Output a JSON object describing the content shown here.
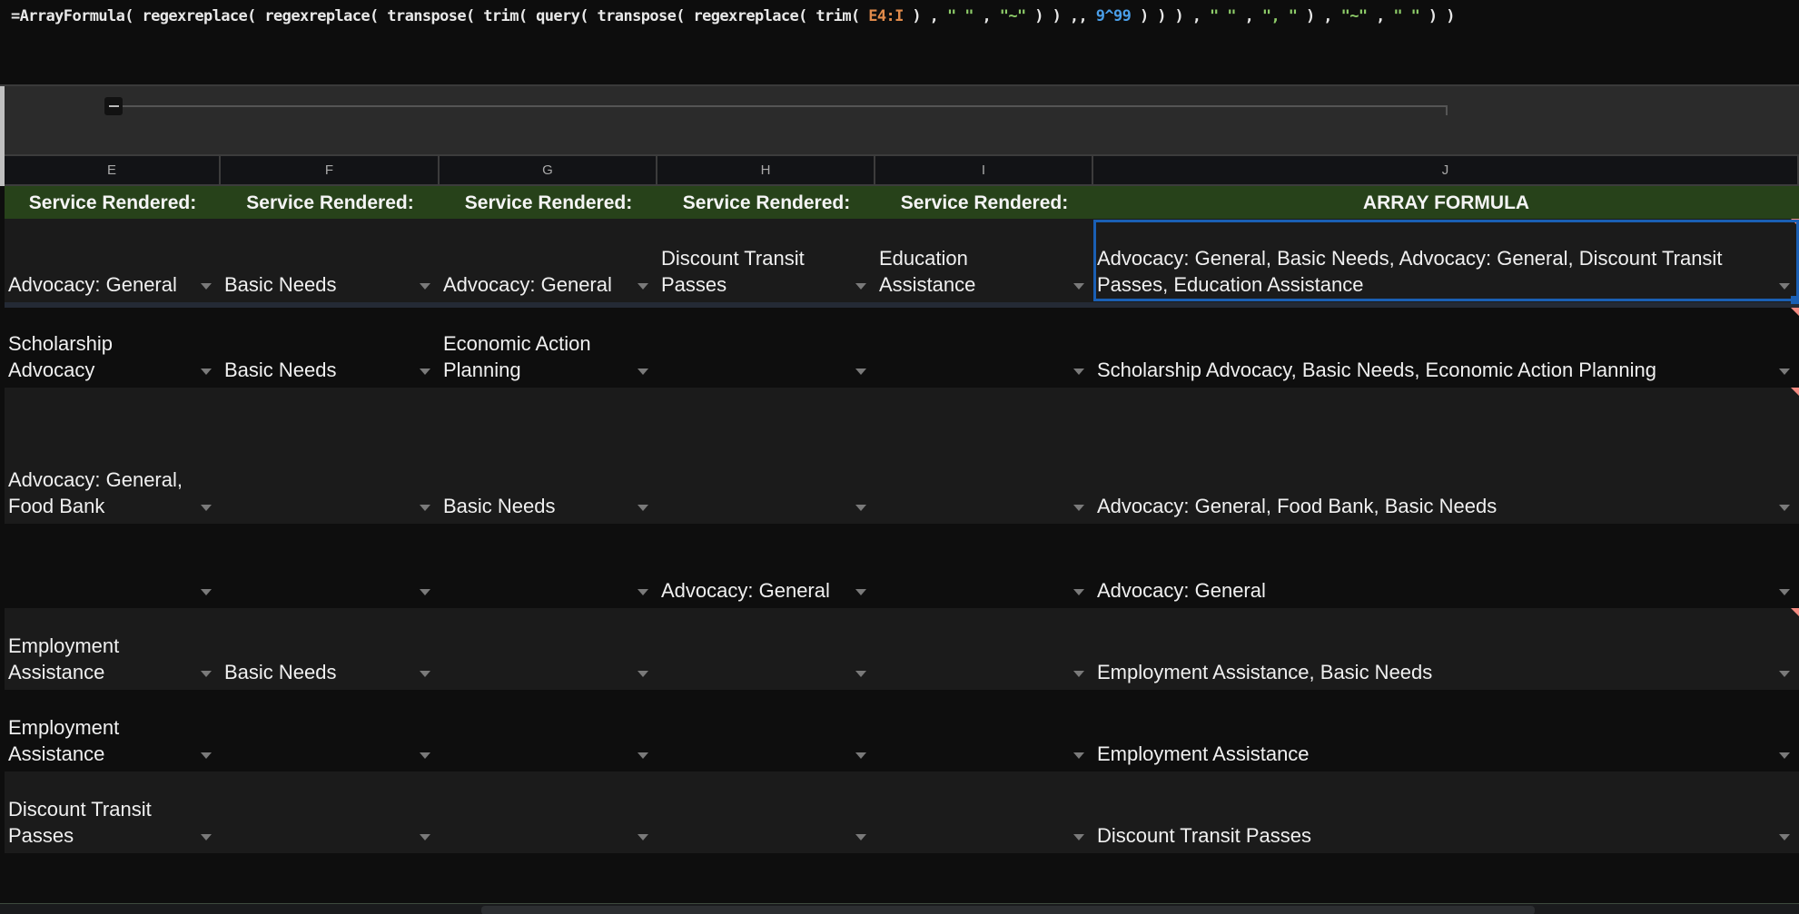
{
  "formula_bar": {
    "parts": [
      {
        "t": "=ArrayFormula( regexreplace( regexreplace( transpose( trim( query( transpose( regexreplace( trim( ",
        "k": "fn"
      },
      {
        "t": "E4:I",
        "k": "range"
      },
      {
        "t": " ) , ",
        "k": "fn"
      },
      {
        "t": "\" \"",
        "k": "str"
      },
      {
        "t": " , ",
        "k": "fn"
      },
      {
        "t": "\"~\"",
        "k": "str"
      },
      {
        "t": " ) ) ,, ",
        "k": "fn"
      },
      {
        "t": "9^99",
        "k": "num"
      },
      {
        "t": " ) ) ) , ",
        "k": "fn"
      },
      {
        "t": "\" \"",
        "k": "str"
      },
      {
        "t": " , ",
        "k": "fn"
      },
      {
        "t": "\", \"",
        "k": "str"
      },
      {
        "t": " ) , ",
        "k": "fn"
      },
      {
        "t": "\"~\"",
        "k": "str"
      },
      {
        "t": " , ",
        "k": "fn"
      },
      {
        "t": "\" \"",
        "k": "str"
      },
      {
        "t": " ) )",
        "k": "fn"
      }
    ]
  },
  "columns": [
    "E",
    "F",
    "G",
    "H",
    "I",
    "J"
  ],
  "header_row": [
    "Service Rendered:",
    "Service Rendered:",
    "Service Rendered:",
    "Service Rendered:",
    "Service Rendered:",
    "ARRAY FORMULA"
  ],
  "rows": [
    {
      "cells": [
        "Advocacy: General",
        "Basic Needs",
        "Advocacy: General",
        "Discount Transit Passes",
        "Education Assistance",
        "Advocacy: General, Basic Needs, Advocacy: General, Discount Transit Passes, Education Assistance"
      ],
      "selected_col": 5,
      "notes": [
        5
      ]
    },
    {
      "cells": [
        "Scholarship Advocacy",
        "Basic Needs",
        "Economic Action Planning",
        "",
        "",
        "Scholarship Advocacy, Basic Needs, Economic Action Planning"
      ],
      "notes": [
        5
      ],
      "notes_bottom": [
        0
      ]
    },
    {
      "cells": [
        "Advocacy: General, Food Bank",
        "",
        "Basic Needs",
        "",
        "",
        "Advocacy: General, Food Bank, Basic Needs"
      ],
      "notes": [
        5
      ]
    },
    {
      "cells": [
        "",
        "",
        "",
        "Advocacy: General",
        "",
        "Advocacy: General"
      ],
      "notes": []
    },
    {
      "cells": [
        "Employment Assistance",
        "Basic Needs",
        "",
        "",
        "",
        "Employment Assistance, Basic Needs"
      ],
      "notes": [
        5
      ]
    },
    {
      "cells": [
        "Employment Assistance",
        "",
        "",
        "",
        "",
        "Employment Assistance"
      ],
      "notes": []
    },
    {
      "cells": [
        "Discount Transit Passes",
        "",
        "",
        "",
        "",
        "Discount Transit Passes"
      ],
      "notes": []
    }
  ],
  "icons": {
    "group_toggle": "minus-icon",
    "dropdown": "chevron-down-icon",
    "note": "comment-marker-icon"
  },
  "colors": {
    "header_green": "#27421a",
    "selection_blue": "#1a5fb4",
    "note_red": "#f28b82"
  }
}
